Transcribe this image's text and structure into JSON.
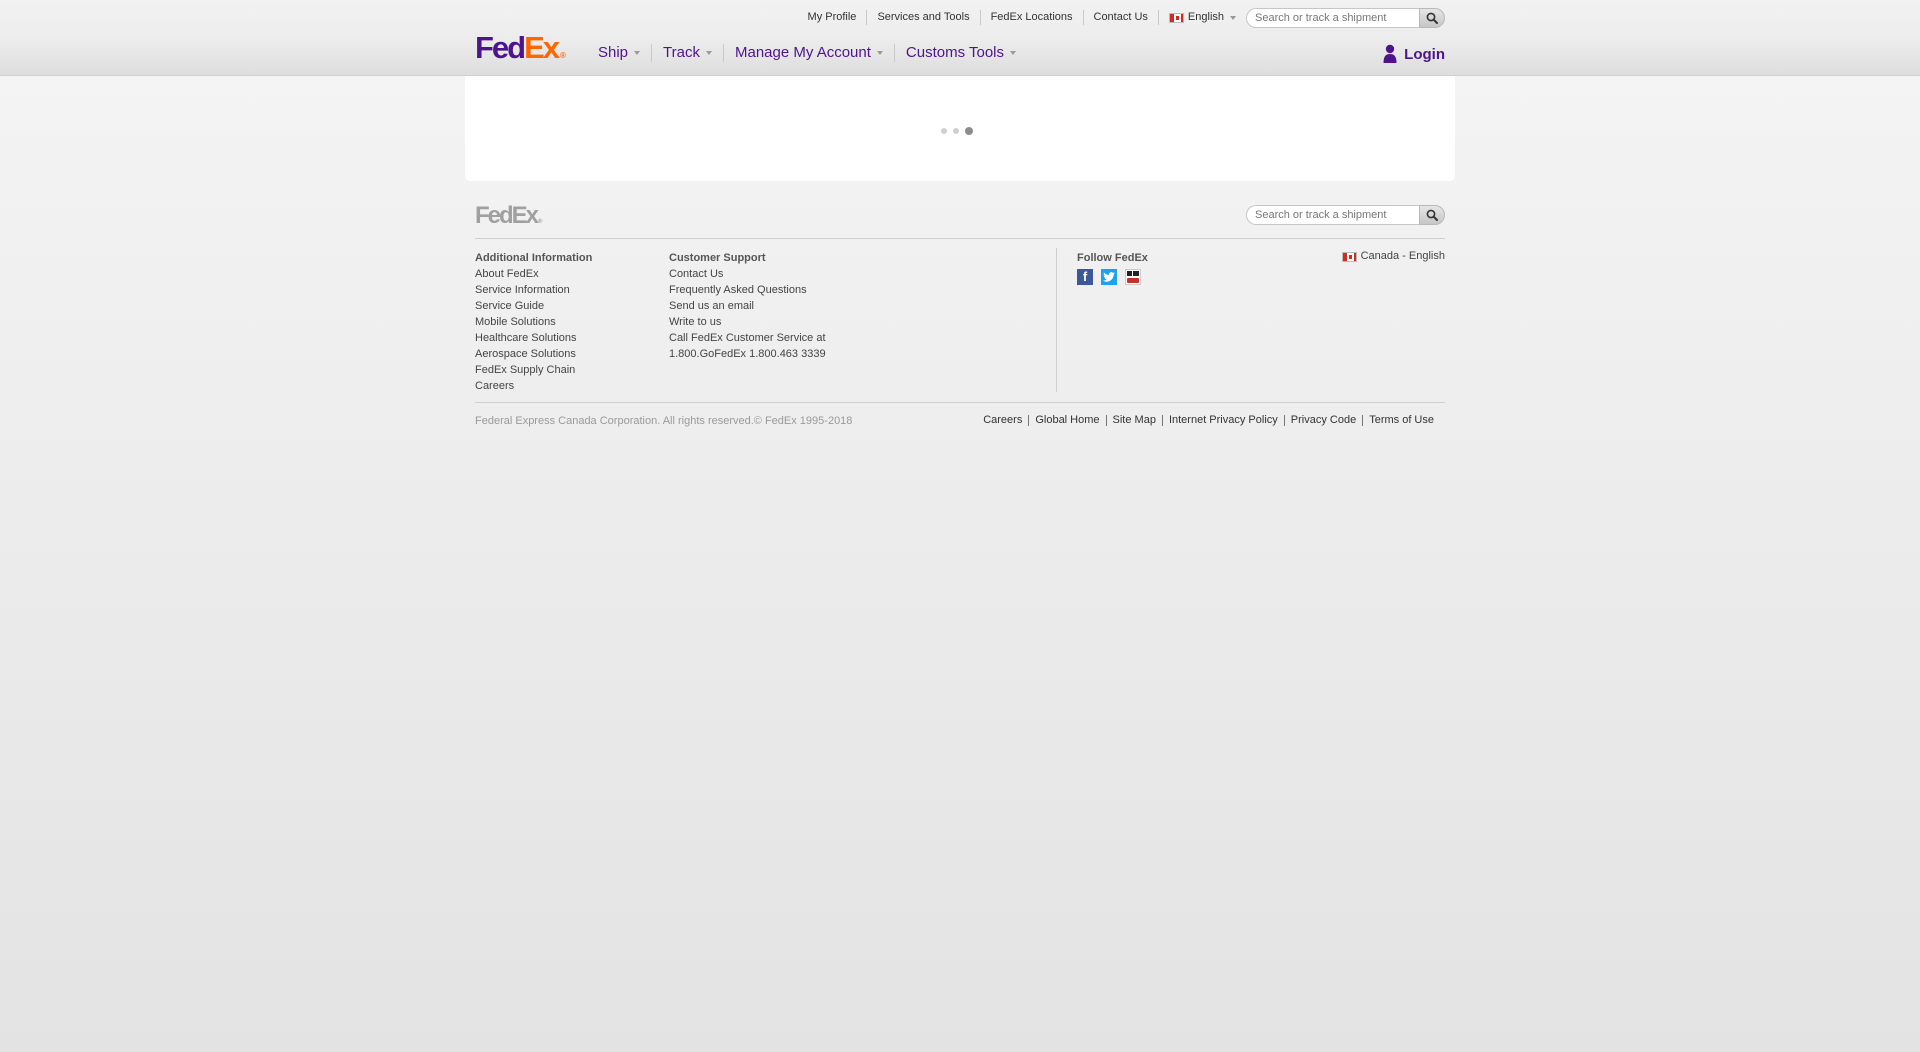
{
  "brand": {
    "logo_fed": "Fed",
    "logo_ex": "Ex",
    "logo_mark": "®",
    "purple": "#4d148c",
    "orange": "#ff6600"
  },
  "utility_nav": {
    "items": [
      "My Profile",
      "Services and Tools",
      "FedEx Locations",
      "Contact Us"
    ],
    "language": "English",
    "language_flag": "canada-flag-icon"
  },
  "search": {
    "placeholder": "Search or track a shipment",
    "button_icon": "search-icon"
  },
  "main_nav": {
    "items": [
      "Ship",
      "Track",
      "Manage My Account",
      "Customs Tools"
    ]
  },
  "login": {
    "label": "Login",
    "icon": "user-icon"
  },
  "content": {
    "loading_indicator": "loading-dots"
  },
  "footer": {
    "logo_fed": "Fed",
    "logo_ex": "Ex",
    "search_placeholder": "Search or track a shipment",
    "additional_info": {
      "heading": "Additional Information",
      "links": [
        "About FedEx",
        "Service Information",
        "Service Guide",
        "Mobile Solutions",
        "Healthcare Solutions",
        "Aerospace Solutions",
        "FedEx Supply Chain",
        "Careers"
      ]
    },
    "customer_support": {
      "heading": "Customer Support",
      "links": [
        "Contact Us",
        "Frequently Asked Questions",
        "Send us an email",
        "Write to us"
      ],
      "phone_line1": "Call FedEx Customer Service at",
      "phone_line2": "1.800.GoFedEx 1.800.463 3339"
    },
    "follow": {
      "heading": "Follow FedEx",
      "icons": [
        "facebook-icon",
        "twitter-icon",
        "youtube-icon"
      ]
    },
    "country": "Canada - English",
    "copyright": "Federal Express Canada Corporation. All rights reserved.© FedEx 1995-2018",
    "bottom_links": [
      "Careers",
      "Global Home",
      "Site Map",
      "Internet Privacy Policy",
      "Privacy Code",
      "Terms of Use"
    ]
  }
}
